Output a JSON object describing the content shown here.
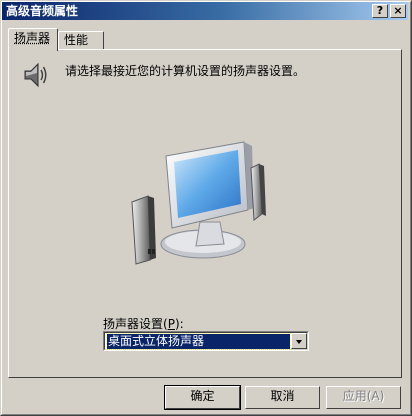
{
  "window": {
    "title": "高级音频属性",
    "help_label": "?",
    "close_label": "×"
  },
  "tabs": [
    {
      "label": "扬声器",
      "active": true
    },
    {
      "label": "性能",
      "active": false
    }
  ],
  "speakers_tab": {
    "icon": "speaker-icon",
    "instruction": "请选择最接近您的计算机设置的扬声器设置。",
    "setup_label_prefix": "扬声器设置(",
    "setup_label_accel": "P",
    "setup_label_suffix": "):",
    "setup_selected": "桌面式立体扬声器"
  },
  "buttons": {
    "ok": "确定",
    "cancel": "取消",
    "apply": "应用(A)"
  },
  "colors": {
    "title_start": "#0a246a",
    "title_end": "#a6caf0",
    "face": "#d4d0c8",
    "selection": "#0a246a"
  }
}
